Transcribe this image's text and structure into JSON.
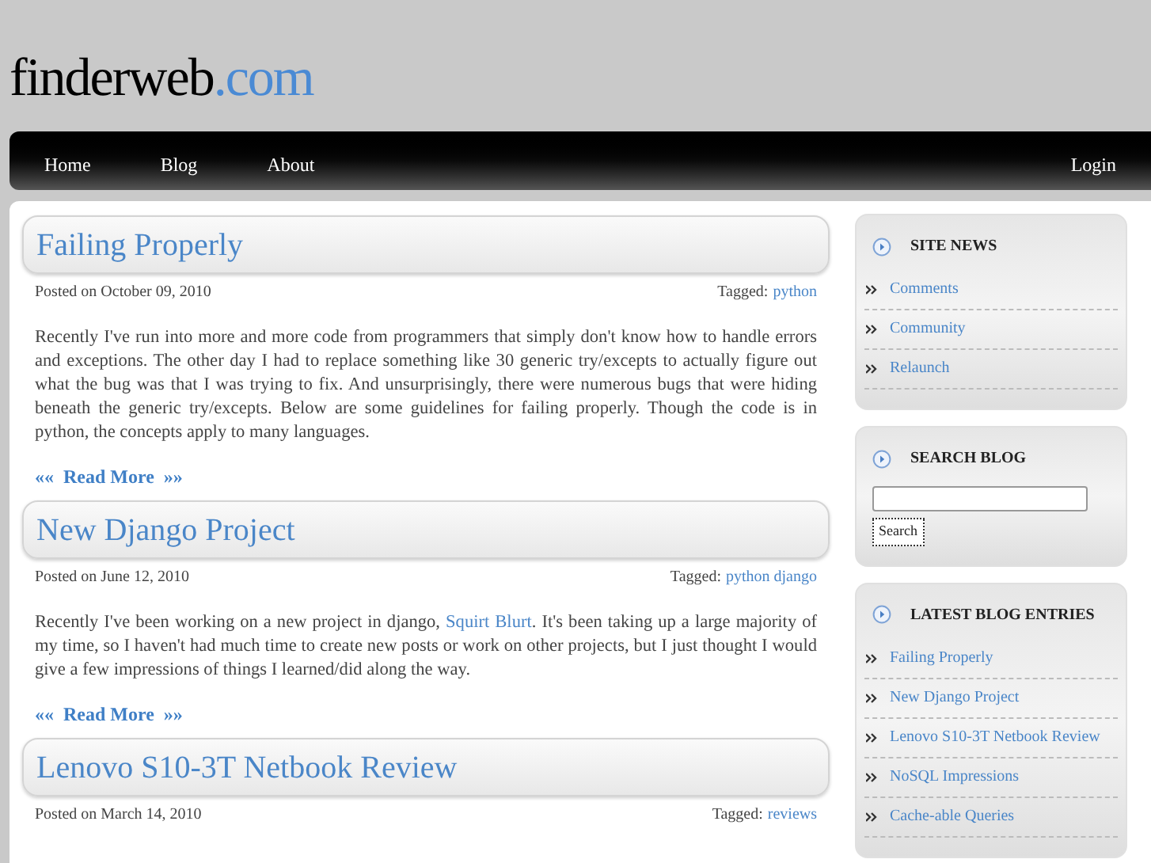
{
  "logo": {
    "name": "finderweb",
    "tld": ".com"
  },
  "nav": {
    "left": [
      "Home",
      "Blog",
      "About"
    ],
    "right": [
      "Login"
    ]
  },
  "posts": [
    {
      "title": "Failing Properly",
      "posted": "Posted on October 09, 2010",
      "tagged_label": "Tagged:",
      "tags": [
        "python"
      ],
      "body": [
        {
          "kind": "text",
          "text": "Recently I've run into more and more code from programmers that simply don't know how to handle errors and exceptions. The other day I had to replace something like 30 generic try/excepts to actually figure out what the bug was that I was trying to fix. And unsurprisingly, there were numerous bugs that were hiding beneath the generic try/excepts. Below are some guidelines for failing properly. Though the code is in python, the concepts apply to many languages."
        }
      ],
      "read_more": "««  Read More  »»"
    },
    {
      "title": "New Django Project",
      "posted": "Posted on June 12, 2010",
      "tagged_label": "Tagged:",
      "tags": [
        "python django"
      ],
      "body": [
        {
          "kind": "text",
          "text": "Recently I've been working on a new project in django, "
        },
        {
          "kind": "link",
          "text": "Squirt Blurt"
        },
        {
          "kind": "text",
          "text": ". It's been taking up a large majority of my time, so I haven't had much time to create new posts or work on other projects, but I just thought I would give a few impressions of things I learned/did along the way."
        }
      ],
      "read_more": "««  Read More  »»"
    },
    {
      "title": "Lenovo S10-3T Netbook Review",
      "posted": "Posted on March 14, 2010",
      "tagged_label": "Tagged:",
      "tags": [
        "reviews"
      ]
    }
  ],
  "sidebar": [
    {
      "kind": "links",
      "title": "SITE NEWS",
      "items": [
        "Comments",
        "Community",
        "Relaunch"
      ]
    },
    {
      "kind": "search",
      "title": "SEARCH BLOG",
      "button": "Search"
    },
    {
      "kind": "links",
      "title": "LATEST BLOG ENTRIES",
      "items": [
        "Failing Properly",
        "New Django Project",
        "Lenovo S10-3T Netbook Review",
        "NoSQL Impressions",
        "Cache-able Queries"
      ]
    }
  ]
}
